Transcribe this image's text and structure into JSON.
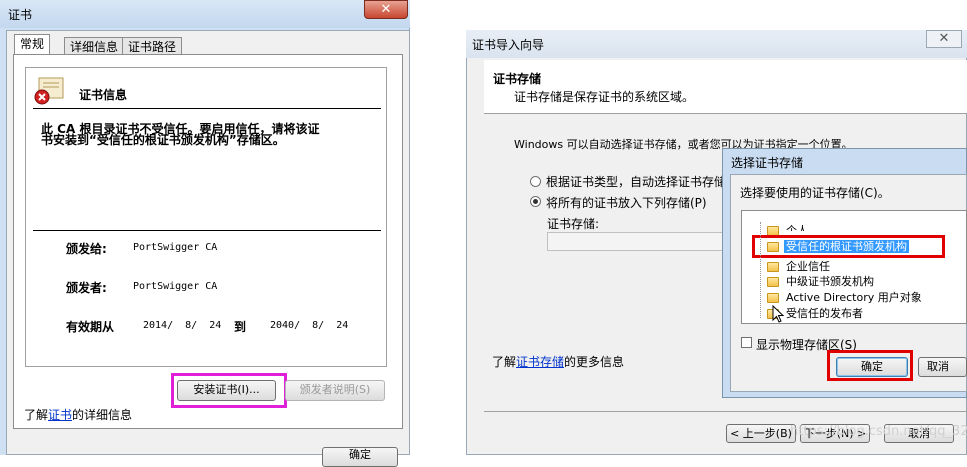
{
  "left_dialog": {
    "title": "证书",
    "close_label": "✕",
    "tabs": [
      "常规",
      "详细信息",
      "证书路径"
    ],
    "info_heading": "证书信息",
    "warning_line1": "此 CA 根目录证书不受信任。要启用信任，请将该证",
    "warning_line2": "书安装到“受信任的根证书颁发机构”存储区。",
    "issued_to_label": "颁发给:",
    "issued_to_value": "PortSwigger CA",
    "issued_by_label": "颁发者:",
    "issued_by_value": "PortSwigger CA",
    "valid_label": "有效期从",
    "valid_from": "2014/  8/  24",
    "valid_to_label": "到",
    "valid_to": "2040/  8/  24",
    "install_button": "安装证书(I)...",
    "issuer_statement_button": "颁发者说明(S)",
    "learn_more_prefix": "了解",
    "learn_more_link": "证书",
    "learn_more_suffix": "的详细信息",
    "bottom_button_partial": "确定"
  },
  "wizard": {
    "title": "证书导入向导",
    "close_label": "✕",
    "header_title": "证书存储",
    "header_desc": "证书存储是保存证书的系统区域。",
    "intro": "Windows 可以自动选择证书存储，或者您可以为证书指定一个位置。",
    "radio_auto": "根据证书类型，自动选择证书存储",
    "radio_manual": "将所有的证书放入下列存储(P)",
    "store_label": "证书存储:",
    "learn_more_prefix": "了解",
    "learn_more_link": "证书存储",
    "learn_more_suffix": "的更多信息",
    "back_button": "< 上一步(B)",
    "next_button": "下一步(N) >",
    "cancel_button": "取消"
  },
  "store_dialog": {
    "title": "选择证书存储",
    "prompt": "选择要使用的证书存储(C)。",
    "tree_items": [
      "个人",
      "受信任的根证书颁发机构",
      "企业信任",
      "中级证书颁发机构",
      "Active Directory 用户对象",
      "受信任的发布者"
    ],
    "selected_index": 1,
    "show_physical": "显示物理存储区(S)",
    "ok_button": "确定",
    "cancel_button": "取消"
  },
  "watermark": "https://blog.csdn.net/qq_32..."
}
